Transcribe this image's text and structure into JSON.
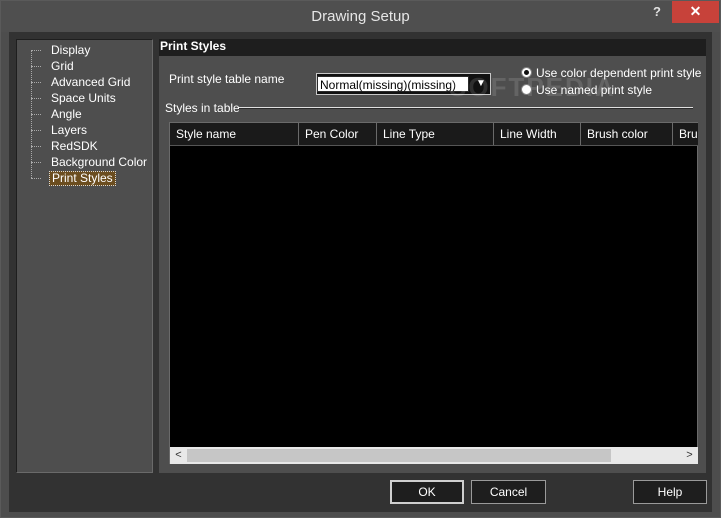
{
  "window": {
    "title": "Drawing Setup",
    "help_button": "?",
    "close_button": "✕"
  },
  "tree": {
    "items": [
      {
        "label": "Display",
        "selected": false
      },
      {
        "label": "Grid",
        "selected": false
      },
      {
        "label": "Advanced Grid",
        "selected": false
      },
      {
        "label": "Space Units",
        "selected": false
      },
      {
        "label": "Angle",
        "selected": false
      },
      {
        "label": "Layers",
        "selected": false
      },
      {
        "label": "RedSDK",
        "selected": false
      },
      {
        "label": "Background Color",
        "selected": false
      },
      {
        "label": "Print Styles",
        "selected": true
      }
    ]
  },
  "panel": {
    "header": "Print Styles",
    "style_table_label": "Print style table name",
    "style_table_value": "Normal(missing)(missing)",
    "radios": [
      {
        "label": "Use color dependent  print style",
        "checked": true
      },
      {
        "label": "Use named print style",
        "checked": false
      }
    ],
    "styles_in_table_label": "Styles in table",
    "table": {
      "columns": [
        "Style name",
        "Pen Color",
        "Line Type",
        "Line Width",
        "Brush color",
        "Brus"
      ],
      "rows": []
    },
    "watermark": "SOFTPEDIA"
  },
  "buttons": {
    "ok": "OK",
    "cancel": "Cancel",
    "help": "Help"
  }
}
